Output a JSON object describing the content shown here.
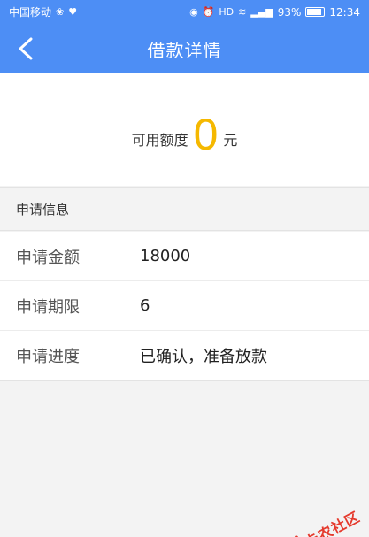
{
  "status_bar": {
    "carrier": "中国移动",
    "battery_percent": "93%",
    "time": "12:34",
    "icons": [
      "location-icon",
      "alarm-icon",
      "hd-icon",
      "wifi-icon",
      "signal-icon",
      "battery-icon"
    ]
  },
  "header": {
    "title": "借款详情",
    "back_icon": "chevron-left-icon",
    "background_color": "#4d8ef5"
  },
  "amount": {
    "label": "可用额度",
    "value": "0",
    "unit": "元",
    "value_color": "#f5b800"
  },
  "section": {
    "title": "申请信息"
  },
  "rows": [
    {
      "key": "申请金额",
      "value": "18000"
    },
    {
      "key": "申请期限",
      "value": "6"
    },
    {
      "key": "申请进度",
      "value": "已确认，准备放款"
    }
  ],
  "watermark": {
    "text": "卡农社区",
    "color": "#e53a2d"
  }
}
